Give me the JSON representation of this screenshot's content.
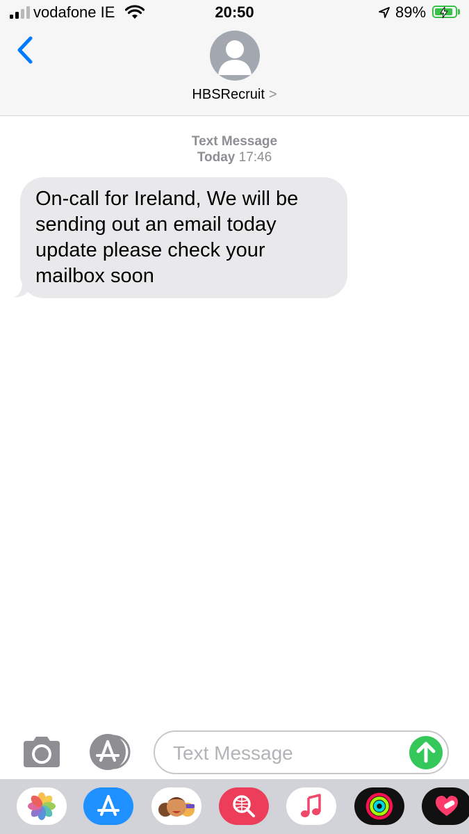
{
  "status_bar": {
    "carrier": "vodafone IE",
    "time": "20:50",
    "battery_percent": "89%",
    "battery_level": 0.89,
    "charging": true,
    "signal_bars": 2,
    "signal_bars_total": 4
  },
  "header": {
    "contact_name": "HBSRecruit",
    "back_icon": "chevron-left-icon",
    "disclosure": ">"
  },
  "conversation": {
    "label_type": "Text Message",
    "label_day": "Today",
    "label_time": "17:46",
    "messages": [
      {
        "direction": "incoming",
        "text": "On-call for Ireland, We will be sending out an email today update please check your mailbox soon"
      }
    ]
  },
  "composer": {
    "placeholder": "Text Message",
    "value": "",
    "camera_icon": "camera-icon",
    "apps_icon": "app-store-icon",
    "send_icon": "arrow-up-icon"
  },
  "app_drawer": {
    "apps": [
      "photos-icon",
      "app-store-icon",
      "memoji-icon",
      "search-web-icon",
      "music-icon",
      "activity-icon",
      "heart-sticker-icon"
    ]
  },
  "colors": {
    "accent_blue": "#007aff",
    "bubble_gray": "#e9e9eb",
    "send_green": "#34c759",
    "battery_green": "#3ac24a"
  }
}
